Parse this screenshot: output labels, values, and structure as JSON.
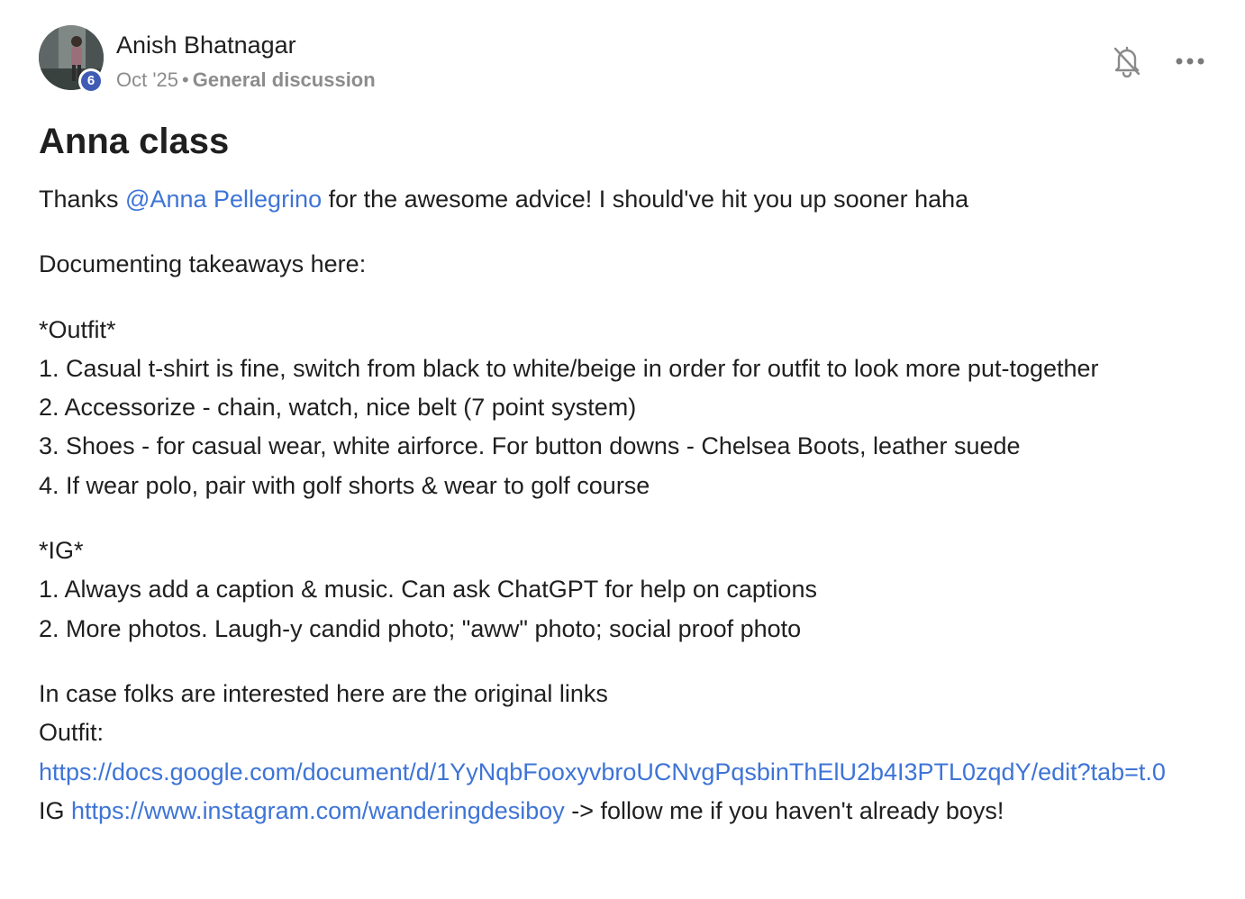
{
  "post": {
    "author": {
      "name": "Anish Bhatnagar",
      "level": "6",
      "avatar_icon": "profile-photo"
    },
    "date": "Oct '25",
    "separator": "•",
    "category": "General discussion",
    "actions": {
      "bell_icon": "bell-off-icon",
      "more_icon": "more-horizontal-icon"
    },
    "title": "Anna class",
    "body": {
      "intro_before": "Thanks ",
      "mention": "@Anna Pellegrino",
      "intro_after": " for the awesome advice! I should've hit you up sooner haha",
      "documenting": "Documenting takeaways here:",
      "outfit_heading": "*Outfit*",
      "outfit_items": [
        "1. Casual t-shirt is fine, switch from black to white/beige in order for outfit to look more put-together",
        "2. Accessorize - chain, watch, nice belt (7 point system)",
        "3. Shoes - for casual wear, white airforce. For button downs - Chelsea Boots, leather suede",
        "4. If wear polo, pair with golf shorts & wear to golf course"
      ],
      "ig_heading": "*IG*",
      "ig_items": [
        "1. Always add a caption & music. Can ask ChatGPT for help on captions",
        "2. More photos. Laugh-y candid photo; \"aww\" photo; social proof photo"
      ],
      "links_intro": "In case folks are interested here are the original links",
      "outfit_label": "Outfit:",
      "outfit_link": "https://docs.google.com/document/d/1YyNqbFooxyvbroUCNvgPqsbinThElU2b4I3PTL0zqdY/edit?tab=t.0",
      "ig_label": "IG ",
      "ig_link": "https://www.instagram.com/wanderingdesiboy",
      "ig_after": " -> follow me if you haven't already boys!"
    }
  },
  "colors": {
    "link": "#3e74d6",
    "badge": "#3f5bb4",
    "meta": "#8c8c8c",
    "text": "#1f1f1f"
  }
}
